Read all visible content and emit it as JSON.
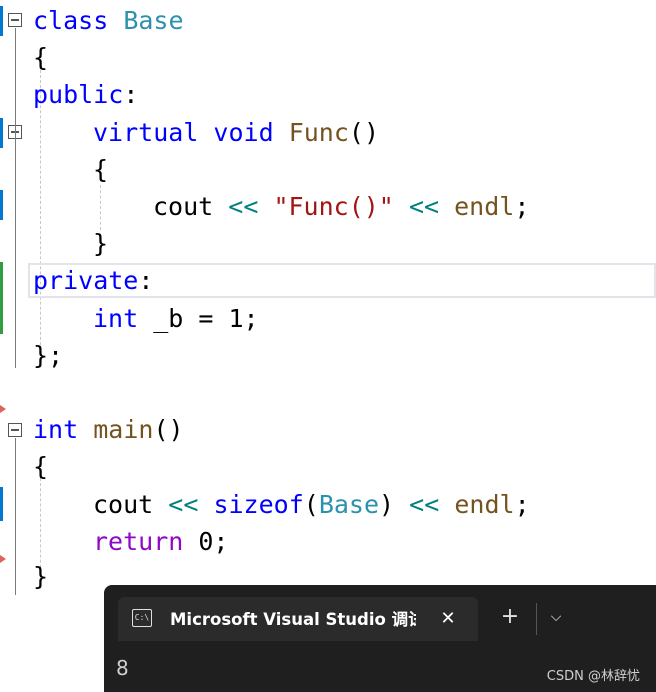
{
  "code": {
    "l1": {
      "kw": "class",
      "name": "Base"
    },
    "l2": {
      "text": "{"
    },
    "l3": {
      "kw": "public",
      "colon": ":"
    },
    "l4": {
      "kw1": "virtual",
      "kw2": "void",
      "fn": "Func",
      "paren": "()"
    },
    "l5": {
      "text": "{"
    },
    "l6": {
      "a": "cout",
      "op1": "<<",
      "str": "\"Func()\"",
      "op2": "<<",
      "b": "endl",
      "semi": ";"
    },
    "l7": {
      "text": "}"
    },
    "l8": {
      "kw": "private",
      "colon": ":"
    },
    "l9": {
      "kw": "int",
      "rest": "_b = 1;"
    },
    "l10": {
      "text": "};"
    },
    "l11": {
      "kw": "int",
      "fn": "main",
      "paren": "()"
    },
    "l12": {
      "text": "{"
    },
    "l13": {
      "a": "cout",
      "op1": "<<",
      "kw": "sizeof",
      "p1": "(",
      "ty": "Base",
      "p2": ")",
      "op2": "<<",
      "b": "endl",
      "semi": ";"
    },
    "l14": {
      "kw": "return",
      "rest": "0;"
    },
    "l15": {
      "text": "}"
    }
  },
  "terminal": {
    "tab_icon": "C:\\",
    "tab_title": "Microsoft Visual Studio 调试控制台",
    "close_glyph": "✕",
    "new_tab_glyph": "+",
    "dropdown_glyph": "⌵",
    "output": "8"
  },
  "watermark": "CSDN @林辞忧",
  "colors": {
    "keyword": "#0000ff",
    "type": "#2b91af",
    "function": "#74531f",
    "string": "#a31515",
    "operator": "#008080",
    "control": "#8f08c4",
    "terminal_bg": "#1f1f1f"
  }
}
